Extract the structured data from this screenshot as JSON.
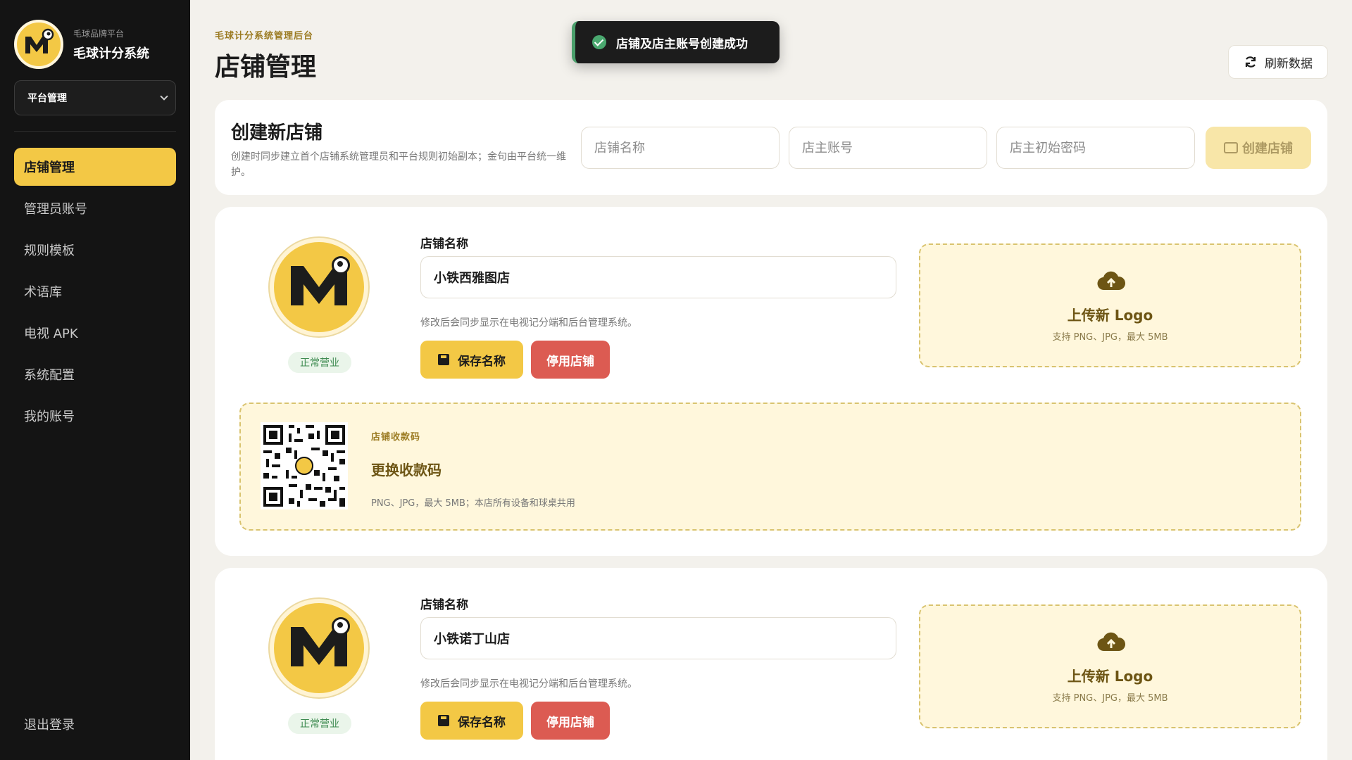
{
  "brand": {
    "subtitle": "毛球品牌平台",
    "title": "毛球计分系统"
  },
  "scope_select": {
    "value": "平台管理"
  },
  "nav": {
    "items": [
      {
        "label": "店铺管理",
        "active": true
      },
      {
        "label": "管理员账号",
        "active": false
      },
      {
        "label": "规则模板",
        "active": false
      },
      {
        "label": "术语库",
        "active": false
      },
      {
        "label": "电视 APK",
        "active": false
      },
      {
        "label": "系统配置",
        "active": false
      },
      {
        "label": "我的账号",
        "active": false
      }
    ],
    "logout": "退出登录"
  },
  "header": {
    "eyebrow": "毛球计分系统管理后台",
    "title": "店铺管理",
    "refresh_label": "刷新数据"
  },
  "toast": {
    "message": "店铺及店主账号创建成功"
  },
  "create": {
    "title": "创建新店铺",
    "description": "创建时同步建立首个店铺系统管理员和平台规则初始副本；金句由平台统一维护。",
    "store_name_placeholder": "店铺名称",
    "owner_account_placeholder": "店主账号",
    "owner_password_placeholder": "店主初始密码",
    "button_label": "创建店铺"
  },
  "stores": [
    {
      "status": "正常营业",
      "name_label": "店铺名称",
      "name_value": "小铁西雅图店",
      "hint": "修改后会同步显示在电视记分端和后台管理系统。",
      "save_label": "保存名称",
      "disable_label": "停用店铺",
      "upload_title": "上传新 Logo",
      "upload_sub": "支持 PNG、JPG，最大 5MB",
      "qr": {
        "eyebrow": "店铺收款码",
        "title": "更换收款码",
        "desc": "PNG、JPG，最大 5MB；本店所有设备和球桌共用"
      }
    },
    {
      "status": "正常营业",
      "name_label": "店铺名称",
      "name_value": "小铁诺丁山店",
      "hint": "修改后会同步显示在电视记分端和后台管理系统。",
      "save_label": "保存名称",
      "disable_label": "停用店铺",
      "upload_title": "上传新 Logo",
      "upload_sub": "支持 PNG、JPG，最大 5MB"
    }
  ],
  "colors": {
    "accent": "#f3c845",
    "danger": "#dc5b52",
    "sidebar": "#141414",
    "success": "#4aa86f"
  }
}
